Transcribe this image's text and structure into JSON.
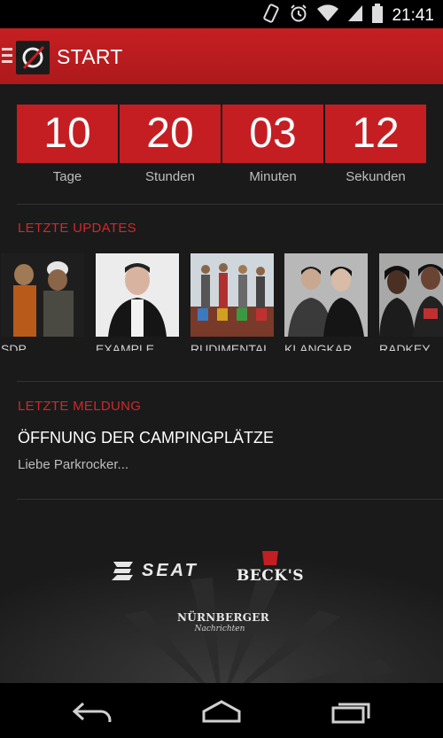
{
  "status_bar": {
    "time": "21:41",
    "icons": [
      "rotate-icon",
      "alarm-icon",
      "wifi-icon",
      "signal-icon",
      "battery-icon"
    ]
  },
  "app_bar": {
    "title": "START",
    "menu_icon": "menu-icon",
    "logo_icon": "festival-logo-icon"
  },
  "countdown": [
    {
      "value": "10",
      "label": "Tage"
    },
    {
      "value": "20",
      "label": "Stunden"
    },
    {
      "value": "03",
      "label": "Minuten"
    },
    {
      "value": "12",
      "label": "Sekunden"
    }
  ],
  "updates": {
    "title": "LETZTE UPDATES",
    "items": [
      {
        "name": "SDP"
      },
      {
        "name": "EXAMPLE"
      },
      {
        "name": "RUDIMENTAL"
      },
      {
        "name": "KLANGKARUSSELL"
      },
      {
        "name": "RADKEY"
      }
    ]
  },
  "news": {
    "title": "LETZTE MELDUNG",
    "headline": "ÖFFNUNG DER CAMPINGPLÄTZE",
    "teaser": "Liebe Parkrocker..."
  },
  "sponsors": [
    {
      "name": "SEAT"
    },
    {
      "name": "BECK'S"
    },
    {
      "name": "NÜRNBERGER",
      "subname": "Nachrichten"
    }
  ],
  "nav_bar": {
    "buttons": [
      "back-icon",
      "home-icon",
      "recent-apps-icon"
    ]
  },
  "colors": {
    "accent": "#c41e22",
    "background": "#1a1a1a",
    "text_muted": "#bdbdbd"
  }
}
